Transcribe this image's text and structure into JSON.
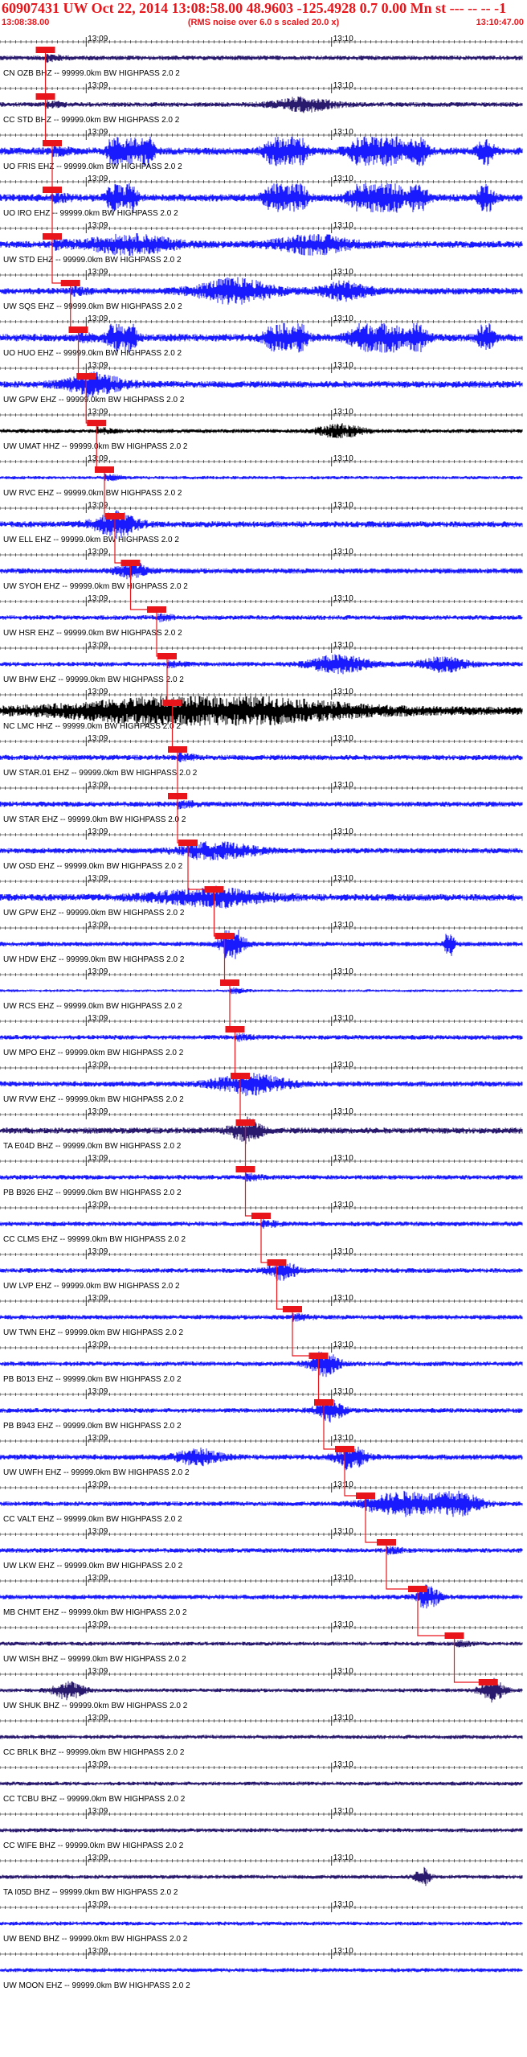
{
  "header": {
    "title": "60907431 UW Oct 22, 2014 13:08:58.00   48.9603 -125.4928  0.7 0.00 Mn st --- -- -- -1",
    "start_time": "13:08:38.00",
    "note": "(RMS noise over 6.0 s scaled 20.0 x)",
    "end_time": "13:10:47.00"
  },
  "time_marks": [
    "13:09",
    "13:10"
  ],
  "colors": {
    "header_text": "#e8151b",
    "pick": "#e8151b",
    "trace_blue": "#1a1aff",
    "trace_purple": "#2a1a6e",
    "trace_black": "#000000",
    "label": "#000000"
  },
  "stations": [
    {
      "label": "CN OZB BHZ -- 99999.0km BW  HIGHPASS  2.0  2",
      "amp": 0.35,
      "color": "purple",
      "pick": 0.087,
      "bursts": []
    },
    {
      "label": "CC STD BHZ -- 99999.0km BW  HIGHPASS  2.0  2",
      "amp": 0.35,
      "color": "purple",
      "pick": 0.087,
      "bursts": [
        [
          0.58,
          0.04,
          0.9
        ]
      ]
    },
    {
      "label": "UO FRIS EHZ -- 99999.0km BW  HIGHPASS  2.0  2",
      "amp": 0.55,
      "color": "blue",
      "pick": 0.1,
      "bursts": [
        [
          0.22,
          0.01,
          2.2
        ],
        [
          0.25,
          0.008,
          2.2
        ],
        [
          0.28,
          0.01,
          2.2
        ],
        [
          0.53,
          0.015,
          2.2
        ],
        [
          0.57,
          0.012,
          2.2
        ],
        [
          0.7,
          0.02,
          2.2
        ],
        [
          0.75,
          0.015,
          2.2
        ],
        [
          0.8,
          0.012,
          2.2
        ],
        [
          0.93,
          0.01,
          2.2
        ]
      ]
    },
    {
      "label": "UO IRO EHZ -- 99999.0km BW  HIGHPASS  2.0  2",
      "amp": 0.55,
      "color": "blue",
      "pick": 0.1,
      "bursts": [
        [
          0.22,
          0.01,
          2.2
        ],
        [
          0.25,
          0.008,
          2.2
        ],
        [
          0.53,
          0.015,
          2.2
        ],
        [
          0.57,
          0.012,
          2.2
        ],
        [
          0.7,
          0.02,
          2.2
        ],
        [
          0.75,
          0.015,
          2.2
        ],
        [
          0.8,
          0.012,
          2.2
        ],
        [
          0.93,
          0.01,
          2.2
        ]
      ]
    },
    {
      "label": "UW STD EHZ -- 99999.0km BW  HIGHPASS  2.0  2",
      "amp": 0.5,
      "color": "blue",
      "pick": 0.1,
      "bursts": [
        [
          0.25,
          0.06,
          1.2
        ],
        [
          0.6,
          0.05,
          1.2
        ]
      ]
    },
    {
      "label": "UW SQS EHZ -- 99999.0km BW  HIGHPASS  2.0  2",
      "amp": 0.5,
      "color": "blue",
      "pick": 0.135,
      "bursts": [
        [
          0.45,
          0.05,
          1.6
        ],
        [
          0.66,
          0.03,
          1.2
        ]
      ]
    },
    {
      "label": "UO HUO EHZ -- 99999.0km BW  HIGHPASS  2.0  2",
      "amp": 0.55,
      "color": "blue",
      "pick": 0.15,
      "bursts": [
        [
          0.22,
          0.01,
          2.2
        ],
        [
          0.25,
          0.008,
          2.2
        ],
        [
          0.53,
          0.015,
          2.2
        ],
        [
          0.57,
          0.012,
          2.2
        ],
        [
          0.7,
          0.02,
          2.2
        ],
        [
          0.75,
          0.015,
          2.2
        ],
        [
          0.8,
          0.012,
          2.2
        ],
        [
          0.93,
          0.01,
          2.2
        ]
      ]
    },
    {
      "label": "UW GPW EHZ -- 99999.0km BW  HIGHPASS  2.0  2",
      "amp": 0.5,
      "color": "blue",
      "pick": 0.165,
      "bursts": [
        [
          0.18,
          0.04,
          1.2
        ]
      ]
    },
    {
      "label": "UW UMAT HHZ -- 99999.0km BW  HIGHPASS  2.0  2",
      "amp": 0.3,
      "color": "black",
      "pick": 0.185,
      "bursts": [
        [
          0.65,
          0.03,
          0.9
        ]
      ]
    },
    {
      "label": "UW RVC EHZ -- 99999.0km BW  HIGHPASS  2.0  2",
      "amp": 0.25,
      "color": "blue",
      "pick": 0.2,
      "bursts": []
    },
    {
      "label": "UW ELL EHZ -- 99999.0km BW  HIGHPASS  2.0  2",
      "amp": 0.45,
      "color": "blue",
      "pick": 0.22,
      "bursts": [
        [
          0.22,
          0.03,
          1.4
        ]
      ]
    },
    {
      "label": "UW SYOH EHZ -- 99999.0km BW  HIGHPASS  2.0  2",
      "amp": 0.4,
      "color": "blue",
      "pick": 0.25,
      "bursts": [
        [
          0.25,
          0.02,
          0.9
        ]
      ]
    },
    {
      "label": "UW HSR EHZ -- 99999.0km BW  HIGHPASS  2.0  2",
      "amp": 0.35,
      "color": "blue",
      "pick": 0.3,
      "bursts": []
    },
    {
      "label": "UW BHW EHZ -- 99999.0km BW  HIGHPASS  2.0  2",
      "amp": 0.35,
      "color": "blue",
      "pick": 0.32,
      "bursts": [
        [
          0.65,
          0.04,
          1.2
        ],
        [
          0.85,
          0.03,
          1.0
        ]
      ]
    },
    {
      "label": "NC LMC HHZ -- 99999.0km BW  HIGHPASS  2.0  2",
      "amp": 0.6,
      "color": "black",
      "pick": 0.33,
      "bursts": [
        [
          0.4,
          0.18,
          2.0
        ]
      ]
    },
    {
      "label": "UW STAR.01 EHZ -- 99999.0km BW  HIGHPASS  2.0  2",
      "amp": 0.4,
      "color": "blue",
      "pick": 0.34,
      "bursts": []
    },
    {
      "label": "UW STAR EHZ -- 99999.0km BW  HIGHPASS  2.0  2",
      "amp": 0.4,
      "color": "blue",
      "pick": 0.34,
      "bursts": []
    },
    {
      "label": "UW OSD EHZ -- 99999.0km BW  HIGHPASS  2.0  2",
      "amp": 0.4,
      "color": "blue",
      "pick": 0.36,
      "bursts": [
        [
          0.42,
          0.05,
          1.0
        ]
      ]
    },
    {
      "label": "UW GPW EHZ -- 99999.0km BW  HIGHPASS  2.0  2",
      "amp": 0.5,
      "color": "blue",
      "pick": 0.41,
      "bursts": [
        [
          0.4,
          0.08,
          1.0
        ]
      ]
    },
    {
      "label": "UW HDW EHZ -- 99999.0km BW  HIGHPASS  2.0  2",
      "amp": 0.35,
      "color": "blue",
      "pick": 0.43,
      "bursts": [
        [
          0.445,
          0.015,
          2.2
        ],
        [
          0.86,
          0.006,
          2.2
        ]
      ]
    },
    {
      "label": "UW RCS EHZ -- 99999.0km BW  HIGHPASS  2.0  2",
      "amp": 0.2,
      "color": "blue",
      "pick": 0.44,
      "bursts": []
    },
    {
      "label": "UW MPO EHZ -- 99999.0km BW  HIGHPASS  2.0  2",
      "amp": 0.35,
      "color": "blue",
      "pick": 0.45,
      "bursts": []
    },
    {
      "label": "UW RVW EHZ -- 99999.0km BW  HIGHPASS  2.0  2",
      "amp": 0.4,
      "color": "blue",
      "pick": 0.46,
      "bursts": [
        [
          0.48,
          0.05,
          1.2
        ]
      ]
    },
    {
      "label": "TA E04D BHZ -- 99999.0km BW  HIGHPASS  2.0  2",
      "amp": 0.45,
      "color": "purple",
      "pick": 0.47,
      "bursts": [
        [
          0.47,
          0.02,
          1.4
        ]
      ]
    },
    {
      "label": "PB B926 EHZ -- 99999.0km BW  HIGHPASS  2.0  2",
      "amp": 0.35,
      "color": "blue",
      "pick": 0.47,
      "bursts": []
    },
    {
      "label": "CC CLMS EHZ -- 99999.0km BW  HIGHPASS  2.0  2",
      "amp": 0.35,
      "color": "blue",
      "pick": 0.5,
      "bursts": []
    },
    {
      "label": "UW LVP EHZ -- 99999.0km BW  HIGHPASS  2.0  2",
      "amp": 0.35,
      "color": "blue",
      "pick": 0.53,
      "bursts": [
        [
          0.54,
          0.02,
          1.0
        ]
      ]
    },
    {
      "label": "UW TWN EHZ -- 99999.0km BW  HIGHPASS  2.0  2",
      "amp": 0.35,
      "color": "blue",
      "pick": 0.56,
      "bursts": []
    },
    {
      "label": "PB B013 EHZ -- 99999.0km BW  HIGHPASS  2.0  2",
      "amp": 0.35,
      "color": "blue",
      "pick": 0.61,
      "bursts": [
        [
          0.62,
          0.02,
          1.4
        ]
      ]
    },
    {
      "label": "PB B943 EHZ -- 99999.0km BW  HIGHPASS  2.0  2",
      "amp": 0.35,
      "color": "blue",
      "pick": 0.62,
      "bursts": [
        [
          0.63,
          0.02,
          1.2
        ]
      ]
    },
    {
      "label": "UW UWFH EHZ -- 99999.0km BW  HIGHPASS  2.0  2",
      "amp": 0.4,
      "color": "blue",
      "pick": 0.66,
      "bursts": [
        [
          0.38,
          0.03,
          1.0
        ],
        [
          0.67,
          0.02,
          1.4
        ]
      ]
    },
    {
      "label": "CC VALT EHZ -- 99999.0km BW  HIGHPASS  2.0  2",
      "amp": 0.35,
      "color": "blue",
      "pick": 0.7,
      "bursts": [
        [
          0.78,
          0.05,
          1.6
        ],
        [
          0.88,
          0.03,
          1.4
        ]
      ]
    },
    {
      "label": "UW LKW EHZ -- 99999.0km BW  HIGHPASS  2.0  2",
      "amp": 0.35,
      "color": "blue",
      "pick": 0.74,
      "bursts": []
    },
    {
      "label": "MB CHMT EHZ -- 99999.0km BW  HIGHPASS  2.0  2",
      "amp": 0.35,
      "color": "blue",
      "pick": 0.8,
      "bursts": [
        [
          0.82,
          0.015,
          1.4
        ]
      ]
    },
    {
      "label": "UW WISH BHZ -- 99999.0km BW  HIGHPASS  2.0  2",
      "amp": 0.3,
      "color": "purple",
      "pick": 0.87,
      "bursts": []
    },
    {
      "label": "UW SHUK BHZ -- 99999.0km BW  HIGHPASS  2.0  2",
      "amp": 0.3,
      "color": "purple",
      "pick": 0.935,
      "bursts": [
        [
          0.13,
          0.02,
          1.2
        ],
        [
          0.94,
          0.015,
          1.4
        ]
      ]
    },
    {
      "label": "CC BRLK BHZ -- 99999.0km BW  HIGHPASS  2.0  2",
      "amp": 0.3,
      "color": "purple",
      "pick": null,
      "bursts": []
    },
    {
      "label": "CC TCBU BHZ -- 99999.0km BW  HIGHPASS  2.0  2",
      "amp": 0.3,
      "color": "purple",
      "pick": null,
      "bursts": []
    },
    {
      "label": "CC WIFE BHZ -- 99999.0km BW  HIGHPASS  2.0  2",
      "amp": 0.3,
      "color": "purple",
      "pick": null,
      "bursts": []
    },
    {
      "label": "TA I05D BHZ -- 99999.0km BW  HIGHPASS  2.0  2",
      "amp": 0.3,
      "color": "purple",
      "pick": null,
      "bursts": [
        [
          0.81,
          0.01,
          1.2
        ]
      ]
    },
    {
      "label": "UW BEND BHZ -- 99999.0km BW  HIGHPASS  2.0  2",
      "amp": 0.3,
      "color": "blue",
      "pick": null,
      "bursts": []
    },
    {
      "label": "UW MOON EHZ -- 99999.0km BW  HIGHPASS  2.0  2",
      "amp": 0.3,
      "color": "blue",
      "pick": null,
      "bursts": []
    }
  ]
}
